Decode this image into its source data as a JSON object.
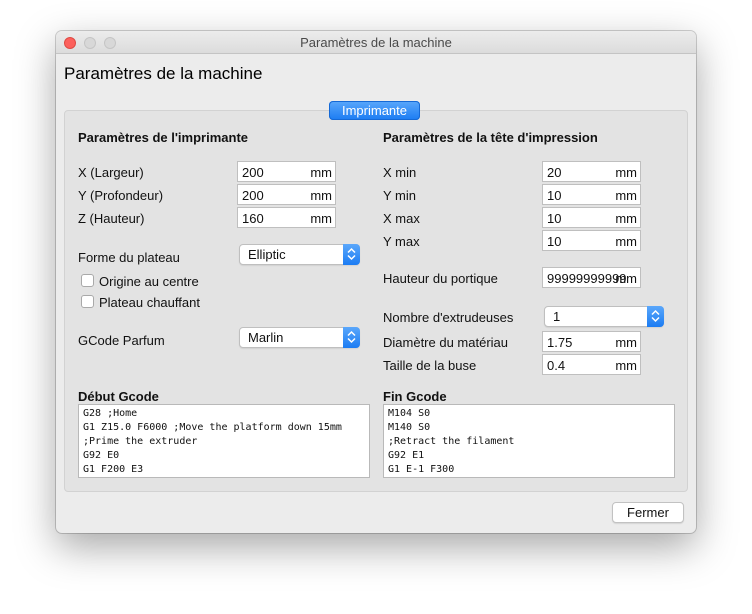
{
  "window": {
    "title": "Paramètres de la machine"
  },
  "dialog": {
    "title": "Paramètres de la machine",
    "tab_label": "Imprimante"
  },
  "printer": {
    "section_title": "Paramètres de l'imprimante",
    "x_label": "X (Largeur)",
    "x_value": "200",
    "x_unit": "mm",
    "y_label": "Y (Profondeur)",
    "y_value": "200",
    "y_unit": "mm",
    "z_label": "Z (Hauteur)",
    "z_value": "160",
    "z_unit": "mm",
    "bed_shape_label": "Forme du plateau",
    "bed_shape_value": "Elliptic",
    "origin_center_label": "Origine au centre",
    "origin_center_checked": false,
    "heated_bed_label": "Plateau chauffant",
    "heated_bed_checked": false,
    "gcode_flavor_label": "GCode Parfum",
    "gcode_flavor_value": "Marlin"
  },
  "printhead": {
    "section_title": "Paramètres de la tête d'impression",
    "xmin_label": "X min",
    "xmin_value": "20",
    "xmin_unit": "mm",
    "ymin_label": "Y min",
    "ymin_value": "10",
    "ymin_unit": "mm",
    "xmax_label": "X max",
    "xmax_value": "10",
    "xmax_unit": "mm",
    "ymax_label": "Y max",
    "ymax_value": "10",
    "ymax_unit": "mm",
    "gantry_label": "Hauteur du portique",
    "gantry_value": "99999999999",
    "gantry_unit": "mm",
    "extruders_label": "Nombre d'extrudeuses",
    "extruders_value": "1",
    "material_diameter_label": "Diamètre du matériau",
    "material_diameter_value": "1.75",
    "material_diameter_unit": "mm",
    "nozzle_size_label": "Taille de la buse",
    "nozzle_size_value": "0.4",
    "nozzle_size_unit": "mm"
  },
  "start_gcode": {
    "label": "Début Gcode",
    "text": "G28 ;Home\nG1 Z15.0 F6000 ;Move the platform down 15mm\n;Prime the extruder\nG92 E0\nG1 F200 E3"
  },
  "end_gcode": {
    "label": "Fin Gcode",
    "text": "M104 S0\nM140 S0\n;Retract the filament\nG92 E1\nG1 E-1 F300"
  },
  "footer": {
    "close_label": "Fermer"
  },
  "colors": {
    "accent": "#1b7cf3",
    "close_dot": "#fc605c"
  }
}
